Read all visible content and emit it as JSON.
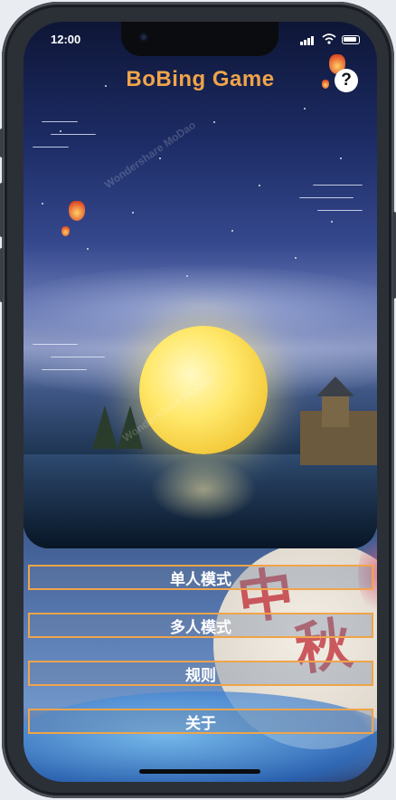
{
  "status_bar": {
    "time": "12:00"
  },
  "header": {
    "title": "BoBing Game",
    "help_label": "?"
  },
  "menu": {
    "items": [
      {
        "label": "单人模式"
      },
      {
        "label": "多人模式"
      },
      {
        "label": "规则"
      },
      {
        "label": "关于"
      }
    ]
  },
  "decor": {
    "calligraphy": [
      "中",
      "秋"
    ]
  },
  "colors": {
    "accent": "#f0a44a",
    "title": "#f0a44a"
  },
  "icons": [
    "help-icon",
    "signal-icon",
    "wifi-icon",
    "battery-icon"
  ]
}
